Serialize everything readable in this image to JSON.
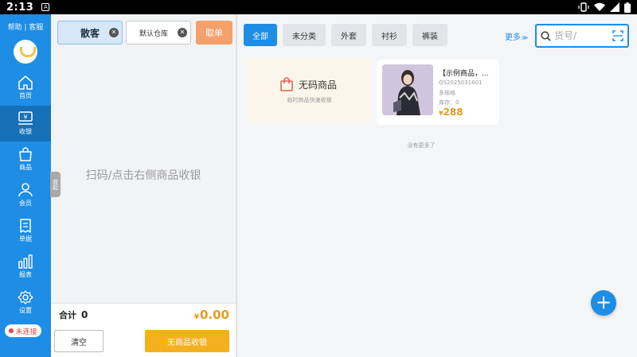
{
  "status_bar": {
    "time": "2:13",
    "notification": "A"
  },
  "sidebar": {
    "help_label": "帮助 | 客服",
    "items": [
      {
        "label": "首页",
        "icon": "home-icon"
      },
      {
        "label": "收银",
        "icon": "cashier-icon",
        "active": true
      },
      {
        "label": "商品",
        "icon": "bag-icon"
      },
      {
        "label": "会员",
        "icon": "user-icon"
      },
      {
        "label": "单据",
        "icon": "receipt-icon"
      },
      {
        "label": "报表",
        "icon": "bar-chart-icon"
      },
      {
        "label": "设置",
        "icon": "gear-icon"
      }
    ],
    "connection_status": "未连接"
  },
  "cart": {
    "customer": "散客",
    "warehouse": "默认仓库",
    "take_order_label": "取单",
    "empty_hint": "扫码/点击右侧商品收银",
    "collapse_label": "收起",
    "total_label": "合计",
    "total_count": "0",
    "currency": "¥",
    "total_amount": "0.00",
    "clear_label": "清空",
    "no_goods_checkout_label": "无商品收银"
  },
  "categories": [
    {
      "label": "全部",
      "active": true
    },
    {
      "label": "未分类"
    },
    {
      "label": "外套"
    },
    {
      "label": "衬衫"
    },
    {
      "label": "裤装"
    }
  ],
  "more_label": "更多",
  "search": {
    "placeholder": "货号/"
  },
  "no_code_card": {
    "title": "无码商品",
    "subtitle": "临时商品快速收银"
  },
  "products": [
    {
      "name": "【示例商品，...",
      "sku": "QS2025031601",
      "spec": "多规格",
      "stock": "库存：0",
      "currency": "¥",
      "price": "288"
    }
  ],
  "no_more_label": "没有更多了",
  "colors": {
    "primary": "#1e8de6",
    "accent": "#f5b11d",
    "price": "#e39a1c",
    "take_order": "#f6a06c"
  }
}
